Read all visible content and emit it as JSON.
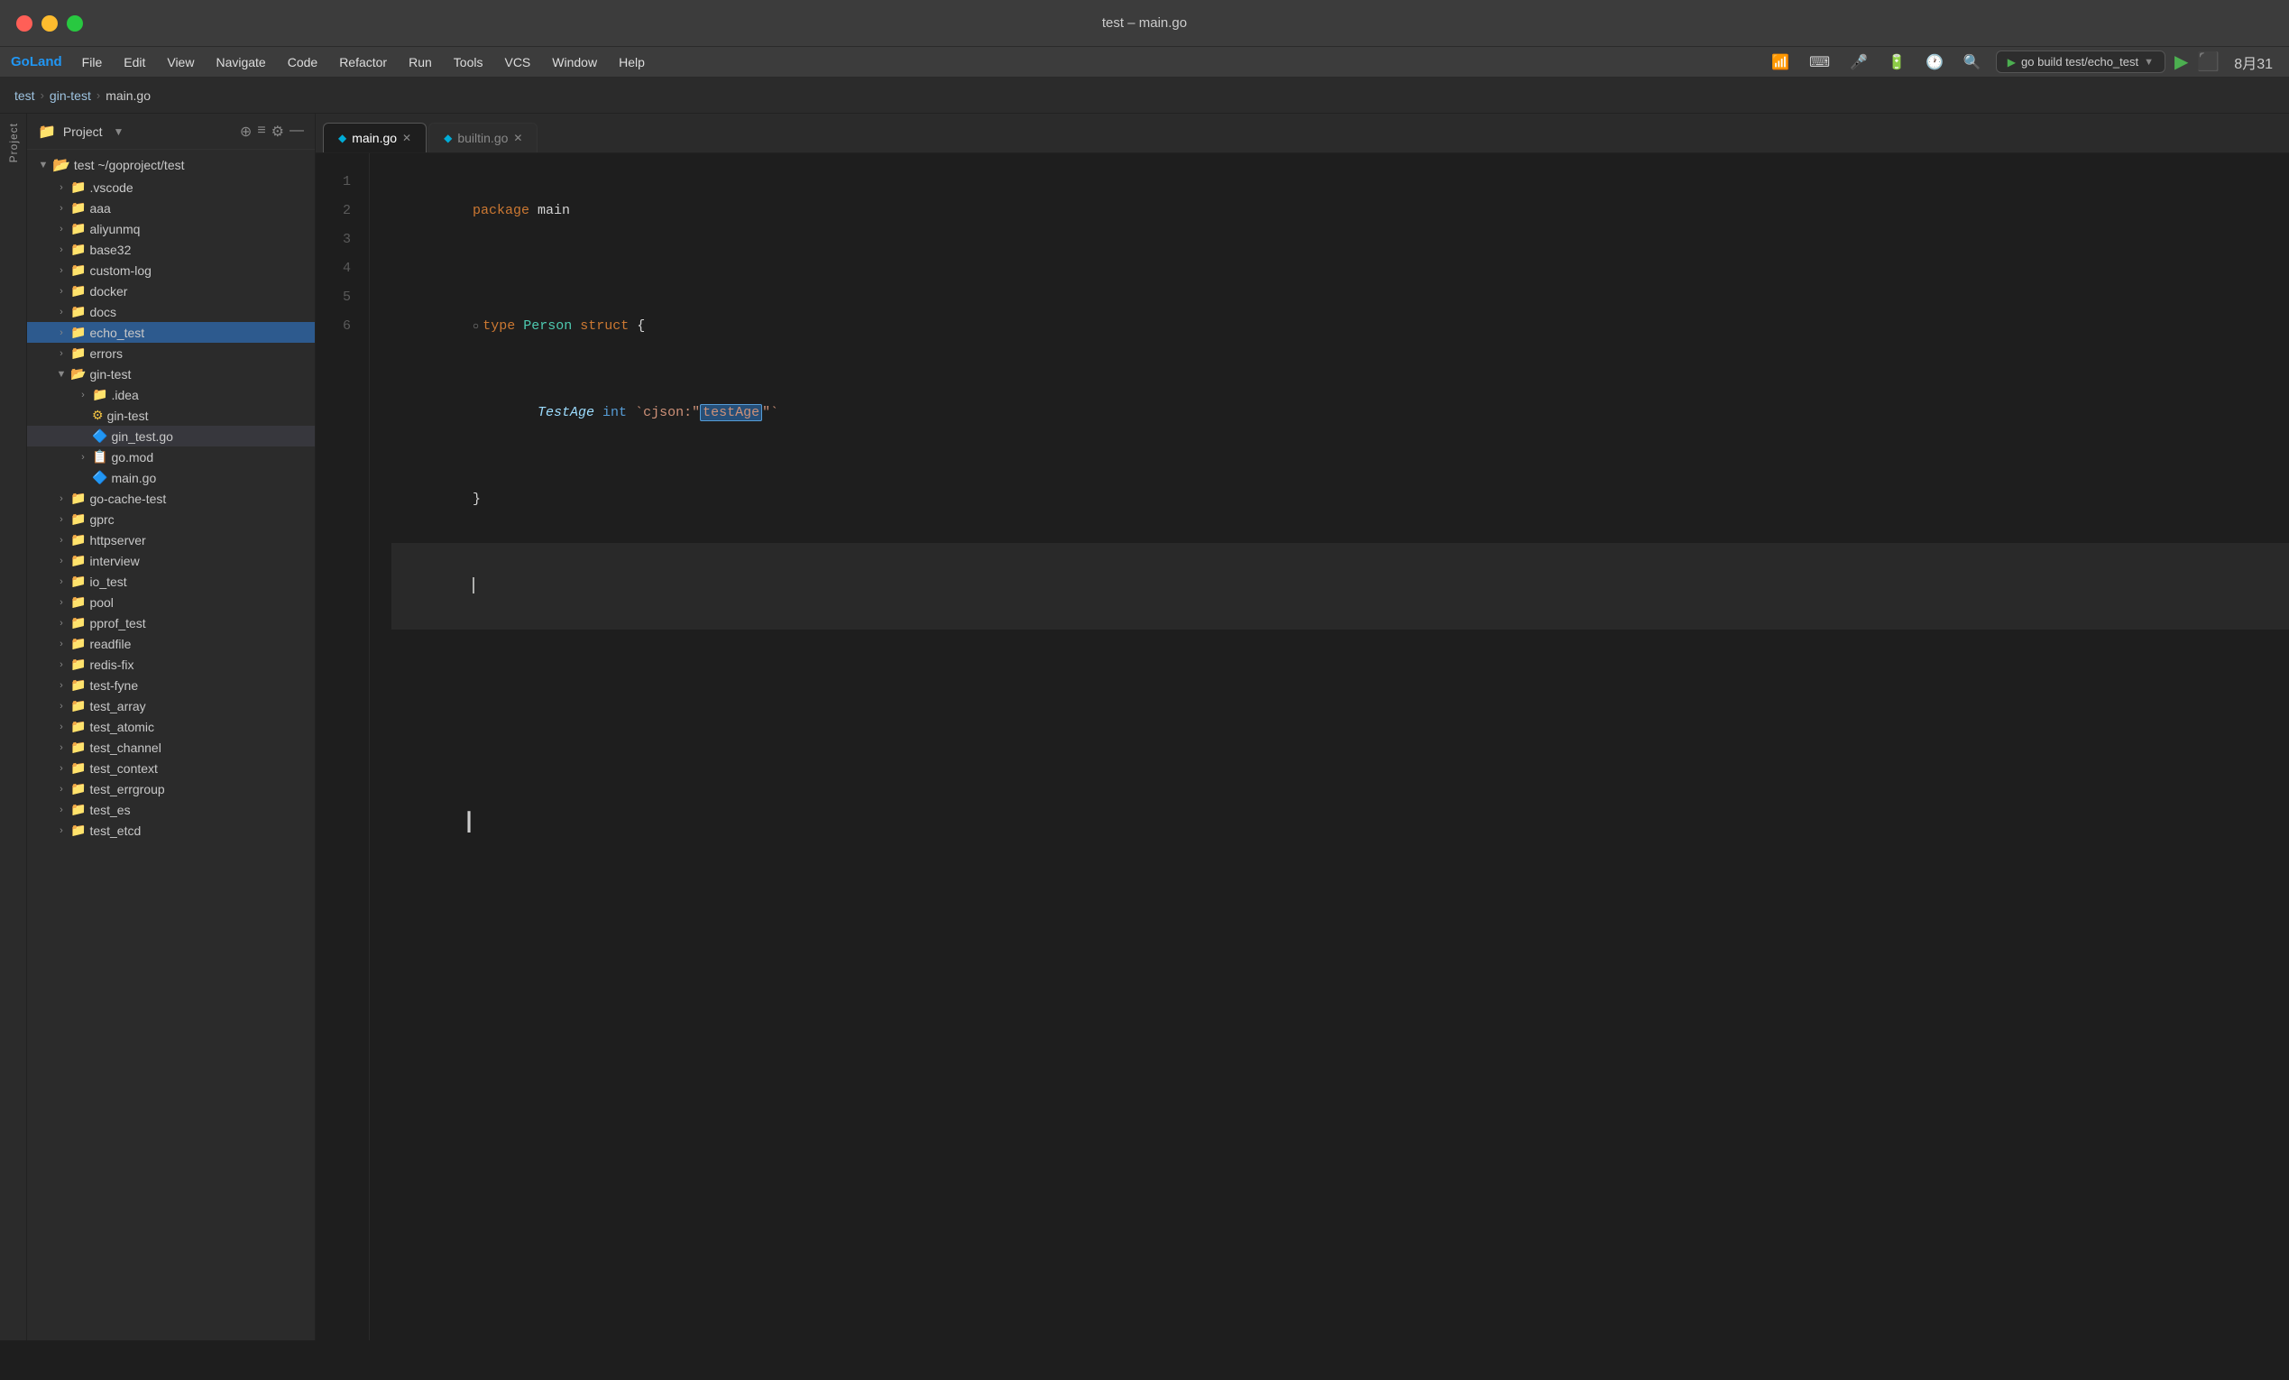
{
  "titlebar": {
    "title": "test – main.go",
    "controls": [
      "close",
      "minimize",
      "maximize"
    ]
  },
  "menubar": {
    "brand": "GoLand",
    "items": [
      "File",
      "Edit",
      "View",
      "Navigate",
      "Code",
      "Refactor",
      "Run",
      "Tools",
      "VCS",
      "Window",
      "Help"
    ],
    "run_config": "go build test/echo_test",
    "time": "8月31"
  },
  "breadcrumb": {
    "items": [
      "test",
      "gin-test",
      "main.go"
    ]
  },
  "sidebar": {
    "title": "Project",
    "root": "test ~/goproject/test",
    "items": [
      {
        "label": ".vscode",
        "type": "folder",
        "depth": 1,
        "collapsed": true
      },
      {
        "label": "aaa",
        "type": "folder",
        "depth": 1,
        "collapsed": true
      },
      {
        "label": "aliyunmq",
        "type": "folder",
        "depth": 1,
        "collapsed": true
      },
      {
        "label": "base32",
        "type": "folder",
        "depth": 1,
        "collapsed": true
      },
      {
        "label": "custom-log",
        "type": "folder",
        "depth": 1,
        "collapsed": true
      },
      {
        "label": "docker",
        "type": "folder",
        "depth": 1,
        "collapsed": true
      },
      {
        "label": "docs",
        "type": "folder",
        "depth": 1,
        "collapsed": true
      },
      {
        "label": "echo_test",
        "type": "folder",
        "depth": 1,
        "collapsed": true,
        "highlighted": true
      },
      {
        "label": "errors",
        "type": "folder",
        "depth": 1,
        "collapsed": true
      },
      {
        "label": "gin-test",
        "type": "folder",
        "depth": 1,
        "expanded": true
      },
      {
        "label": ".idea",
        "type": "folder",
        "depth": 2,
        "collapsed": true
      },
      {
        "label": "gin-test",
        "type": "run",
        "depth": 2
      },
      {
        "label": "gin_test.go",
        "type": "go",
        "depth": 2,
        "selected": true
      },
      {
        "label": "go.mod",
        "type": "mod",
        "depth": 2,
        "collapsed": true
      },
      {
        "label": "main.go",
        "type": "go",
        "depth": 2
      },
      {
        "label": "go-cache-test",
        "type": "folder",
        "depth": 1,
        "collapsed": true
      },
      {
        "label": "gprc",
        "type": "folder",
        "depth": 1,
        "collapsed": true
      },
      {
        "label": "httpserver",
        "type": "folder",
        "depth": 1,
        "collapsed": true
      },
      {
        "label": "interview",
        "type": "folder",
        "depth": 1,
        "collapsed": true
      },
      {
        "label": "io_test",
        "type": "folder",
        "depth": 1,
        "collapsed": true
      },
      {
        "label": "pool",
        "type": "folder",
        "depth": 1,
        "collapsed": true
      },
      {
        "label": "pprof_test",
        "type": "folder",
        "depth": 1,
        "collapsed": true
      },
      {
        "label": "readfile",
        "type": "folder",
        "depth": 1,
        "collapsed": true
      },
      {
        "label": "redis-fix",
        "type": "folder",
        "depth": 1,
        "collapsed": true
      },
      {
        "label": "test-fyne",
        "type": "folder",
        "depth": 1,
        "collapsed": true
      },
      {
        "label": "test_array",
        "type": "folder",
        "depth": 1,
        "collapsed": true
      },
      {
        "label": "test_atomic",
        "type": "folder",
        "depth": 1,
        "collapsed": true
      },
      {
        "label": "test_channel",
        "type": "folder",
        "depth": 1,
        "collapsed": true
      },
      {
        "label": "test_context",
        "type": "folder",
        "depth": 1,
        "collapsed": true
      },
      {
        "label": "test_errgroup",
        "type": "folder",
        "depth": 1,
        "collapsed": true
      },
      {
        "label": "test_es",
        "type": "folder",
        "depth": 1,
        "collapsed": true
      },
      {
        "label": "test_etcd",
        "type": "folder",
        "depth": 1,
        "collapsed": true
      }
    ]
  },
  "tabs": [
    {
      "label": "main.go",
      "active": true,
      "type": "go"
    },
    {
      "label": "builtin.go",
      "active": false,
      "type": "go"
    }
  ],
  "editor": {
    "filename": "main.go",
    "lines": [
      {
        "num": 1,
        "tokens": [
          {
            "text": "package ",
            "class": "kw-pink"
          },
          {
            "text": "main",
            "class": "ident"
          }
        ]
      },
      {
        "num": 2,
        "tokens": []
      },
      {
        "num": 3,
        "tokens": [
          {
            "text": "type ",
            "class": "kw-pink"
          },
          {
            "text": "Person ",
            "class": "type-name"
          },
          {
            "text": "struct ",
            "class": "kw-pink"
          },
          {
            "text": "{",
            "class": "ident"
          }
        ],
        "has_struct_icon": true
      },
      {
        "num": 4,
        "tokens": [
          {
            "text": "    "
          },
          {
            "text": "TestAge ",
            "class": "field-name"
          },
          {
            "text": "int ",
            "class": "kw-blue"
          },
          {
            "text": "`cjson:\"",
            "class": "tag-val"
          },
          {
            "text": "testAge",
            "class": "highlight"
          },
          {
            "text": "\"`",
            "class": "tag-val"
          }
        ]
      },
      {
        "num": 5,
        "tokens": [
          {
            "text": "}"
          }
        ]
      },
      {
        "num": 6,
        "tokens": [],
        "cursor": true
      }
    ]
  }
}
